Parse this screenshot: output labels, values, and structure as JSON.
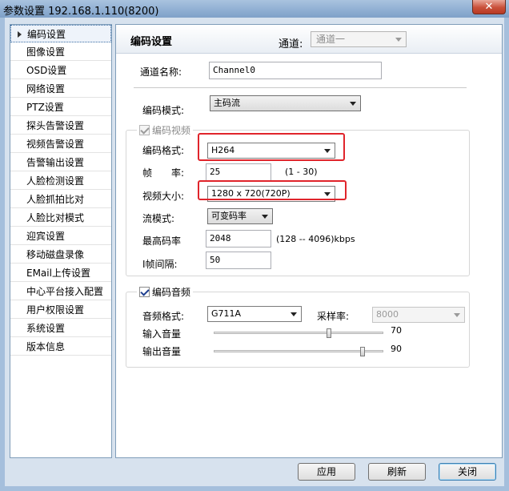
{
  "window": {
    "title": "参数设置 192.168.1.110(8200)",
    "close_glyph": "✕"
  },
  "sidebar": {
    "items": [
      {
        "label": "编码设置",
        "active": true
      },
      {
        "label": "图像设置"
      },
      {
        "label": "OSD设置"
      },
      {
        "label": "网络设置"
      },
      {
        "label": "PTZ设置"
      },
      {
        "label": "探头告警设置"
      },
      {
        "label": "视频告警设置"
      },
      {
        "label": "告警输出设置"
      },
      {
        "label": "人脸检测设置"
      },
      {
        "label": "人脸抓拍比对"
      },
      {
        "label": "人脸比对模式"
      },
      {
        "label": "迎宾设置"
      },
      {
        "label": "移动磁盘录像"
      },
      {
        "label": "EMail上传设置"
      },
      {
        "label": "中心平台接入配置"
      },
      {
        "label": "用户权限设置"
      },
      {
        "label": "系统设置"
      },
      {
        "label": "版本信息"
      }
    ]
  },
  "header": {
    "title": "编码设置",
    "channel_label": "通道:",
    "channel_value": "通道一"
  },
  "form": {
    "channel_name_label": "通道名称:",
    "channel_name_value": "Channel0",
    "encode_mode_label": "编码模式:",
    "encode_mode_value": "主码流",
    "video_group_label": "编码视频",
    "encode_format_label": "编码格式:",
    "encode_format_value": "H264",
    "framerate_label": "帧　　率:",
    "framerate_value": "25",
    "framerate_range": "(1 - 30)",
    "video_size_label": "视频大小:",
    "video_size_value": "1280 x 720(720P)",
    "stream_mode_label": "流模式:",
    "stream_mode_value": "可变码率",
    "max_bitrate_label": "最高码率",
    "max_bitrate_value": "2048",
    "max_bitrate_range": "(128 -- 4096)kbps",
    "iframe_label": "I帧间隔:",
    "iframe_value": "50",
    "audio_group_label": "编码音频",
    "audio_format_label": "音频格式:",
    "audio_format_value": "G711A",
    "sample_rate_label": "采样率:",
    "sample_rate_value": "8000",
    "input_volume_label": "输入音量",
    "input_volume_value": "70",
    "output_volume_label": "输出音量",
    "output_volume_value": "90"
  },
  "buttons": {
    "apply": "应用",
    "refresh": "刷新",
    "close": "关闭"
  }
}
